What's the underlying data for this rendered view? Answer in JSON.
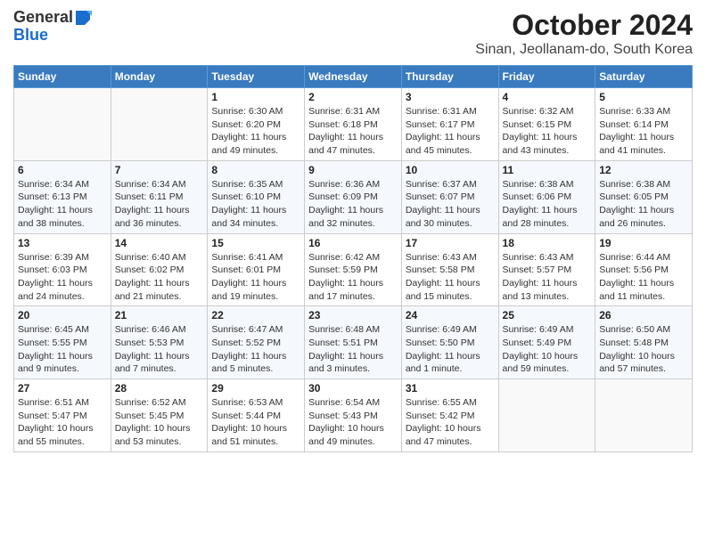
{
  "header": {
    "logo_general": "General",
    "logo_blue": "Blue",
    "title": "October 2024",
    "subtitle": "Sinan, Jeollanam-do, South Korea"
  },
  "days_of_week": [
    "Sunday",
    "Monday",
    "Tuesday",
    "Wednesday",
    "Thursday",
    "Friday",
    "Saturday"
  ],
  "weeks": [
    [
      {
        "day": "",
        "detail": ""
      },
      {
        "day": "",
        "detail": ""
      },
      {
        "day": "1",
        "detail": "Sunrise: 6:30 AM\nSunset: 6:20 PM\nDaylight: 11 hours and 49 minutes."
      },
      {
        "day": "2",
        "detail": "Sunrise: 6:31 AM\nSunset: 6:18 PM\nDaylight: 11 hours and 47 minutes."
      },
      {
        "day": "3",
        "detail": "Sunrise: 6:31 AM\nSunset: 6:17 PM\nDaylight: 11 hours and 45 minutes."
      },
      {
        "day": "4",
        "detail": "Sunrise: 6:32 AM\nSunset: 6:15 PM\nDaylight: 11 hours and 43 minutes."
      },
      {
        "day": "5",
        "detail": "Sunrise: 6:33 AM\nSunset: 6:14 PM\nDaylight: 11 hours and 41 minutes."
      }
    ],
    [
      {
        "day": "6",
        "detail": "Sunrise: 6:34 AM\nSunset: 6:13 PM\nDaylight: 11 hours and 38 minutes."
      },
      {
        "day": "7",
        "detail": "Sunrise: 6:34 AM\nSunset: 6:11 PM\nDaylight: 11 hours and 36 minutes."
      },
      {
        "day": "8",
        "detail": "Sunrise: 6:35 AM\nSunset: 6:10 PM\nDaylight: 11 hours and 34 minutes."
      },
      {
        "day": "9",
        "detail": "Sunrise: 6:36 AM\nSunset: 6:09 PM\nDaylight: 11 hours and 32 minutes."
      },
      {
        "day": "10",
        "detail": "Sunrise: 6:37 AM\nSunset: 6:07 PM\nDaylight: 11 hours and 30 minutes."
      },
      {
        "day": "11",
        "detail": "Sunrise: 6:38 AM\nSunset: 6:06 PM\nDaylight: 11 hours and 28 minutes."
      },
      {
        "day": "12",
        "detail": "Sunrise: 6:38 AM\nSunset: 6:05 PM\nDaylight: 11 hours and 26 minutes."
      }
    ],
    [
      {
        "day": "13",
        "detail": "Sunrise: 6:39 AM\nSunset: 6:03 PM\nDaylight: 11 hours and 24 minutes."
      },
      {
        "day": "14",
        "detail": "Sunrise: 6:40 AM\nSunset: 6:02 PM\nDaylight: 11 hours and 21 minutes."
      },
      {
        "day": "15",
        "detail": "Sunrise: 6:41 AM\nSunset: 6:01 PM\nDaylight: 11 hours and 19 minutes."
      },
      {
        "day": "16",
        "detail": "Sunrise: 6:42 AM\nSunset: 5:59 PM\nDaylight: 11 hours and 17 minutes."
      },
      {
        "day": "17",
        "detail": "Sunrise: 6:43 AM\nSunset: 5:58 PM\nDaylight: 11 hours and 15 minutes."
      },
      {
        "day": "18",
        "detail": "Sunrise: 6:43 AM\nSunset: 5:57 PM\nDaylight: 11 hours and 13 minutes."
      },
      {
        "day": "19",
        "detail": "Sunrise: 6:44 AM\nSunset: 5:56 PM\nDaylight: 11 hours and 11 minutes."
      }
    ],
    [
      {
        "day": "20",
        "detail": "Sunrise: 6:45 AM\nSunset: 5:55 PM\nDaylight: 11 hours and 9 minutes."
      },
      {
        "day": "21",
        "detail": "Sunrise: 6:46 AM\nSunset: 5:53 PM\nDaylight: 11 hours and 7 minutes."
      },
      {
        "day": "22",
        "detail": "Sunrise: 6:47 AM\nSunset: 5:52 PM\nDaylight: 11 hours and 5 minutes."
      },
      {
        "day": "23",
        "detail": "Sunrise: 6:48 AM\nSunset: 5:51 PM\nDaylight: 11 hours and 3 minutes."
      },
      {
        "day": "24",
        "detail": "Sunrise: 6:49 AM\nSunset: 5:50 PM\nDaylight: 11 hours and 1 minute."
      },
      {
        "day": "25",
        "detail": "Sunrise: 6:49 AM\nSunset: 5:49 PM\nDaylight: 10 hours and 59 minutes."
      },
      {
        "day": "26",
        "detail": "Sunrise: 6:50 AM\nSunset: 5:48 PM\nDaylight: 10 hours and 57 minutes."
      }
    ],
    [
      {
        "day": "27",
        "detail": "Sunrise: 6:51 AM\nSunset: 5:47 PM\nDaylight: 10 hours and 55 minutes."
      },
      {
        "day": "28",
        "detail": "Sunrise: 6:52 AM\nSunset: 5:45 PM\nDaylight: 10 hours and 53 minutes."
      },
      {
        "day": "29",
        "detail": "Sunrise: 6:53 AM\nSunset: 5:44 PM\nDaylight: 10 hours and 51 minutes."
      },
      {
        "day": "30",
        "detail": "Sunrise: 6:54 AM\nSunset: 5:43 PM\nDaylight: 10 hours and 49 minutes."
      },
      {
        "day": "31",
        "detail": "Sunrise: 6:55 AM\nSunset: 5:42 PM\nDaylight: 10 hours and 47 minutes."
      },
      {
        "day": "",
        "detail": ""
      },
      {
        "day": "",
        "detail": ""
      }
    ]
  ]
}
